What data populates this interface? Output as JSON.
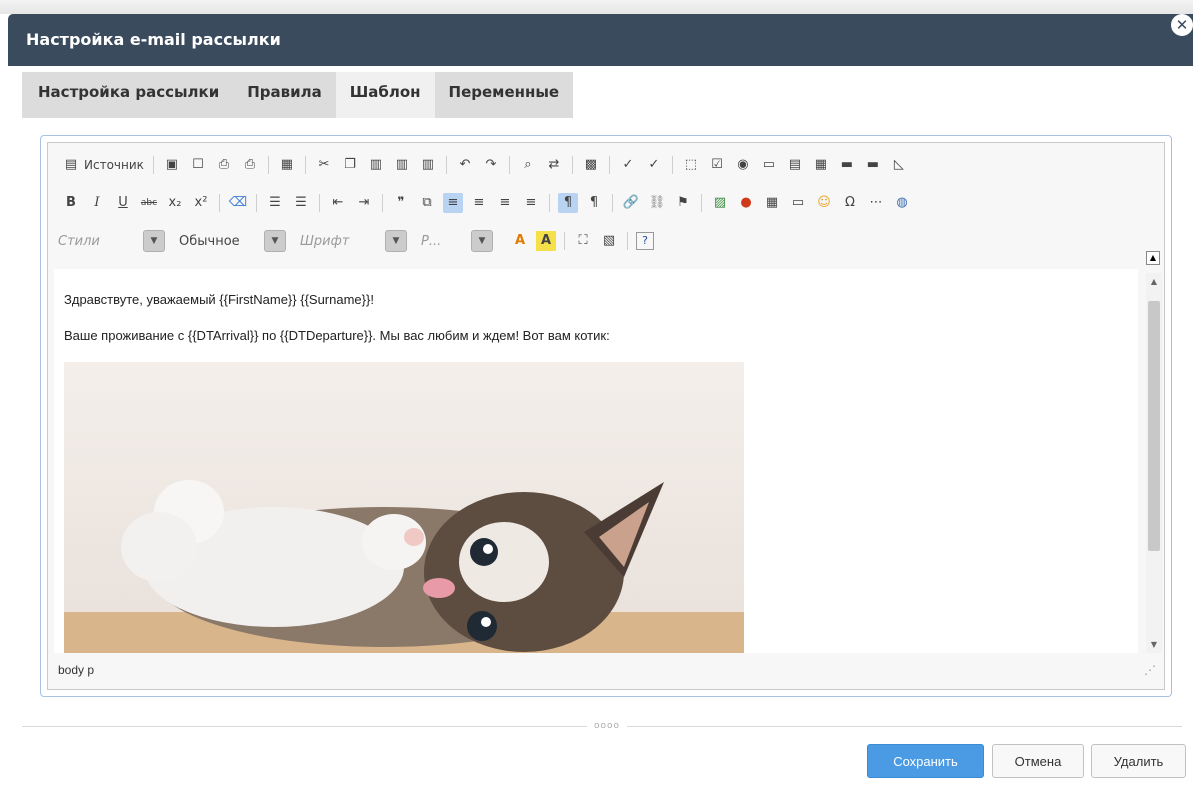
{
  "window": {
    "title": "Настройка e-mail рассылки"
  },
  "tabs": [
    {
      "label": "Настройка рассылки"
    },
    {
      "label": "Правила"
    },
    {
      "label": "Шаблон",
      "active": true
    },
    {
      "label": "Переменные"
    }
  ],
  "toolbar": {
    "source_label": "Источник",
    "styles_placeholder": "Стили",
    "format_value": "Обычное",
    "font_placeholder": "Шрифт",
    "size_placeholder": "Р..."
  },
  "content": {
    "line1": "Здравствуте, уважаемый {{FirstName}} {{Surname}}!",
    "line2": "Ваше проживание с {{DTArrival}} по {{DTDeparture}}. Мы вас любим и ждем! Вот вам котик:"
  },
  "statusbar": {
    "path": "body  p"
  },
  "buttons": {
    "save": "Сохранить",
    "cancel": "Отмена",
    "delete": "Удалить"
  },
  "colors": {
    "titlebar": "#3b4b5e",
    "accent": "#4a9be3",
    "tab_bg": "#dcdcdc"
  }
}
